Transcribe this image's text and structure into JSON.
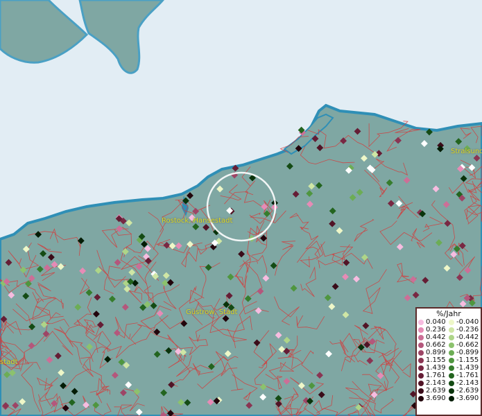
{
  "map": {
    "cities": [
      {
        "id": "rostock",
        "label": "Rostock, Hansestadt"
      },
      {
        "id": "guestrow",
        "label": "Güstrow, Stadt"
      },
      {
        "id": "stralsund",
        "label": "Stralsund"
      },
      {
        "id": "partial-west",
        "label": "stadt"
      }
    ],
    "colors": {
      "sea": "#e2edf4",
      "land": "#7fa7a3",
      "coast": "#2f8fb6",
      "borders": "#d43b3b",
      "selection_ring": "#ffffff"
    }
  },
  "legend": {
    "title": "%/Jahr",
    "positive": [
      {
        "label": "0.040",
        "color": "#f7bce0"
      },
      {
        "label": "0.236",
        "color": "#e68bb6"
      },
      {
        "label": "0.442",
        "color": "#cc6f97"
      },
      {
        "label": "0.662",
        "color": "#b4577c"
      },
      {
        "label": "0.899",
        "color": "#9d4566"
      },
      {
        "label": "1.155",
        "color": "#8a3553"
      },
      {
        "label": "1.439",
        "color": "#782843"
      },
      {
        "label": "1.761",
        "color": "#651d35"
      },
      {
        "label": "2.143",
        "color": "#511426"
      },
      {
        "label": "2.639",
        "color": "#3a0c19"
      },
      {
        "label": "3.690",
        "color": "#22050c"
      }
    ],
    "negative": [
      {
        "label": "-0.040",
        "color": "#eef7c8"
      },
      {
        "label": "-0.236",
        "color": "#cfe6a5"
      },
      {
        "label": "-0.442",
        "color": "#aed588"
      },
      {
        "label": "-0.662",
        "color": "#8cc26d"
      },
      {
        "label": "-0.899",
        "color": "#6cad55"
      },
      {
        "label": "-1.155",
        "color": "#4f963f"
      },
      {
        "label": "-1.439",
        "color": "#367d2d"
      },
      {
        "label": "-1.761",
        "color": "#23641f"
      },
      {
        "label": "-2.143",
        "color": "#144b14"
      },
      {
        "label": "-2.639",
        "color": "#09330b"
      },
      {
        "label": "-3.690",
        "color": "#031c05"
      }
    ]
  }
}
